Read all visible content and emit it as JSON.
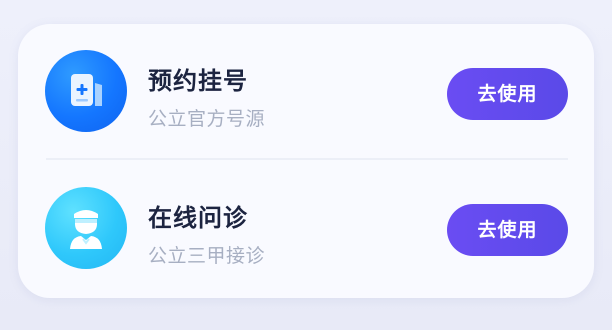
{
  "services": [
    {
      "icon": "document-plus-icon",
      "icon_color": "#1476ff",
      "title": "预约挂号",
      "subtitle": "公立官方号源",
      "button_label": "去使用"
    },
    {
      "icon": "doctor-icon",
      "icon_color": "#2fc8fb",
      "title": "在线问诊",
      "subtitle": "公立三甲接诊",
      "button_label": "去使用"
    }
  ],
  "colors": {
    "button": "#5a4ae8",
    "title": "#1c2440",
    "subtitle": "#a7afc2"
  }
}
